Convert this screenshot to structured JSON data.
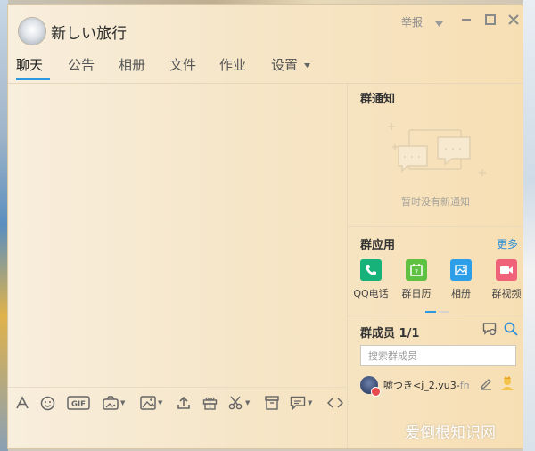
{
  "window": {
    "title": "新しい旅行",
    "report_label": "举报",
    "controls": {
      "dropdown_icon": "chevron-down-icon",
      "minimize_icon": "minimize-icon",
      "maximize_icon": "maximize-icon",
      "close_icon": "close-icon"
    }
  },
  "tabs": [
    {
      "label": "聊天",
      "active": true
    },
    {
      "label": "公告"
    },
    {
      "label": "相册"
    },
    {
      "label": "文件"
    },
    {
      "label": "作业"
    },
    {
      "label": "设置"
    }
  ],
  "toolbar": {
    "icons": [
      "font-icon",
      "emoji-icon",
      "gif-icon",
      "screenshot-icon",
      "image-icon",
      "upload-icon",
      "gift-icon",
      "scissors-icon",
      "archive-icon",
      "voice-message-icon",
      "code-icon"
    ]
  },
  "notice": {
    "title": "群通知",
    "empty_text": "暂时没有新通知"
  },
  "apps": {
    "title": "群应用",
    "more": "更多",
    "items": [
      {
        "label": "QQ电话",
        "color": "#16b27a",
        "icon": "phone-icon"
      },
      {
        "label": "群日历",
        "color": "#5fc142",
        "icon": "calendar-icon"
      },
      {
        "label": "相册",
        "color": "#2d9ee8",
        "icon": "photo-icon"
      },
      {
        "label": "群视频",
        "color": "#f0627a",
        "icon": "video-icon"
      }
    ]
  },
  "members": {
    "title": "群成员 1/1",
    "search_placeholder": "搜索群成员",
    "list": [
      {
        "name": "嘘つき<j_2.yu3-",
        "name_faded": "fm"
      }
    ]
  },
  "watermark": "爱倒根知识网",
  "colors": {
    "accent": "#2b9ae0",
    "link": "#2b8ed8"
  }
}
